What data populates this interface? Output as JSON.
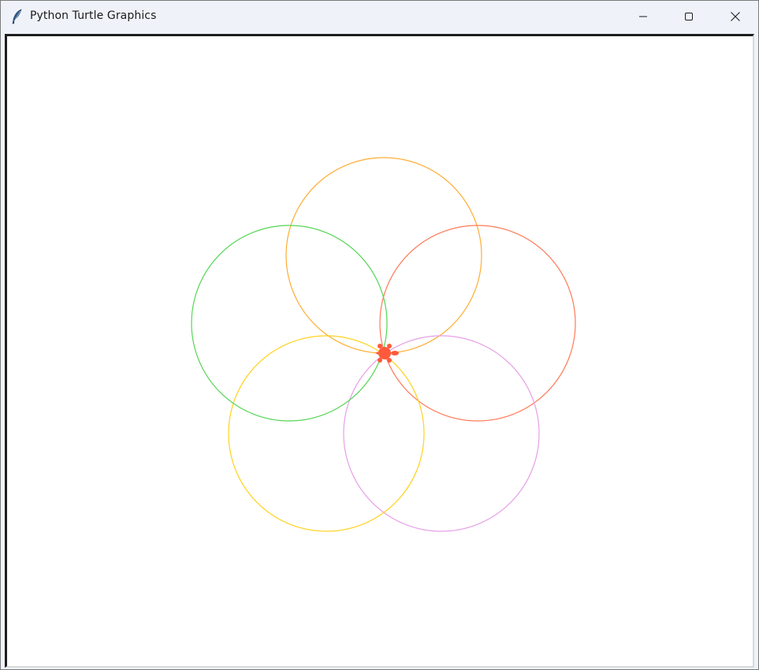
{
  "window": {
    "title": "Python Turtle Graphics",
    "icon": "feather-icon",
    "controls": {
      "minimize": "minimize-icon",
      "maximize": "maximize-icon",
      "close": "close-icon"
    }
  },
  "canvas": {
    "background": "#ffffff",
    "circles": [
      {
        "name": "orange-circle",
        "color": "#ffad33"
      },
      {
        "name": "red-circle",
        "color": "#ff7a59"
      },
      {
        "name": "violet-circle",
        "color": "#e6a0e6"
      },
      {
        "name": "gold-circle",
        "color": "#ffd21f"
      },
      {
        "name": "green-circle",
        "color": "#55d655"
      }
    ],
    "turtle": {
      "name": "turtle-cursor",
      "color": "#ff5a3c"
    }
  }
}
